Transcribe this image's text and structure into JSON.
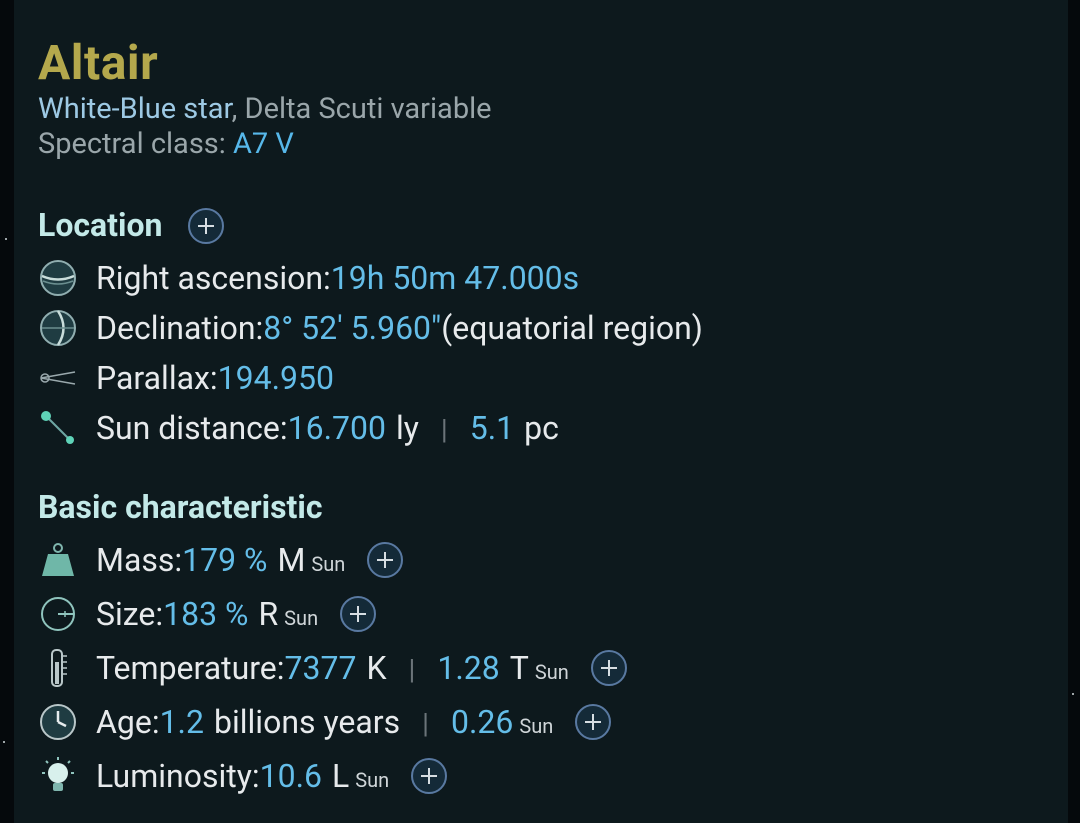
{
  "header": {
    "name": "Altair",
    "star_type": "White-Blue star",
    "variable_suffix": ", Delta Scuti variable",
    "spectral_label": "Spectral class: ",
    "spectral_value": "A7 V"
  },
  "location": {
    "title": "Location",
    "ra_label": "Right ascension: ",
    "ra_value": "19h 50m 47.000s",
    "dec_label": "Declination: ",
    "dec_value": "8° 52' 5.960\"",
    "dec_note": " (equatorial region)",
    "parallax_label": "Parallax: ",
    "parallax_value": "194.950",
    "distance_label": "Sun distance: ",
    "distance_ly_value": "16.700",
    "distance_ly_unit": "ly",
    "separator": "|",
    "distance_pc_value": "5.1",
    "distance_pc_unit": "pc"
  },
  "basic": {
    "title": "Basic characteristic",
    "mass_label": "Mass: ",
    "mass_value": "179 %",
    "mass_unit": "M",
    "size_label": "Size: ",
    "size_value": "183 %",
    "size_unit": "R",
    "temp_label": "Temperature: ",
    "temp_value": "7377",
    "temp_unit": "K",
    "temp_rel_value": "1.28",
    "temp_rel_unit": "T",
    "age_label": "Age: ",
    "age_value": "1.2",
    "age_unit": "billions years",
    "age_rel_value": "0.26",
    "lum_label": "Luminosity: ",
    "lum_value": "10.6",
    "lum_unit": "L",
    "sun_sub": "Sun"
  },
  "colors": {
    "title": "#b4a84c",
    "section": "#c3e9e8",
    "value": "#64bde8",
    "background": "#0d191d"
  }
}
